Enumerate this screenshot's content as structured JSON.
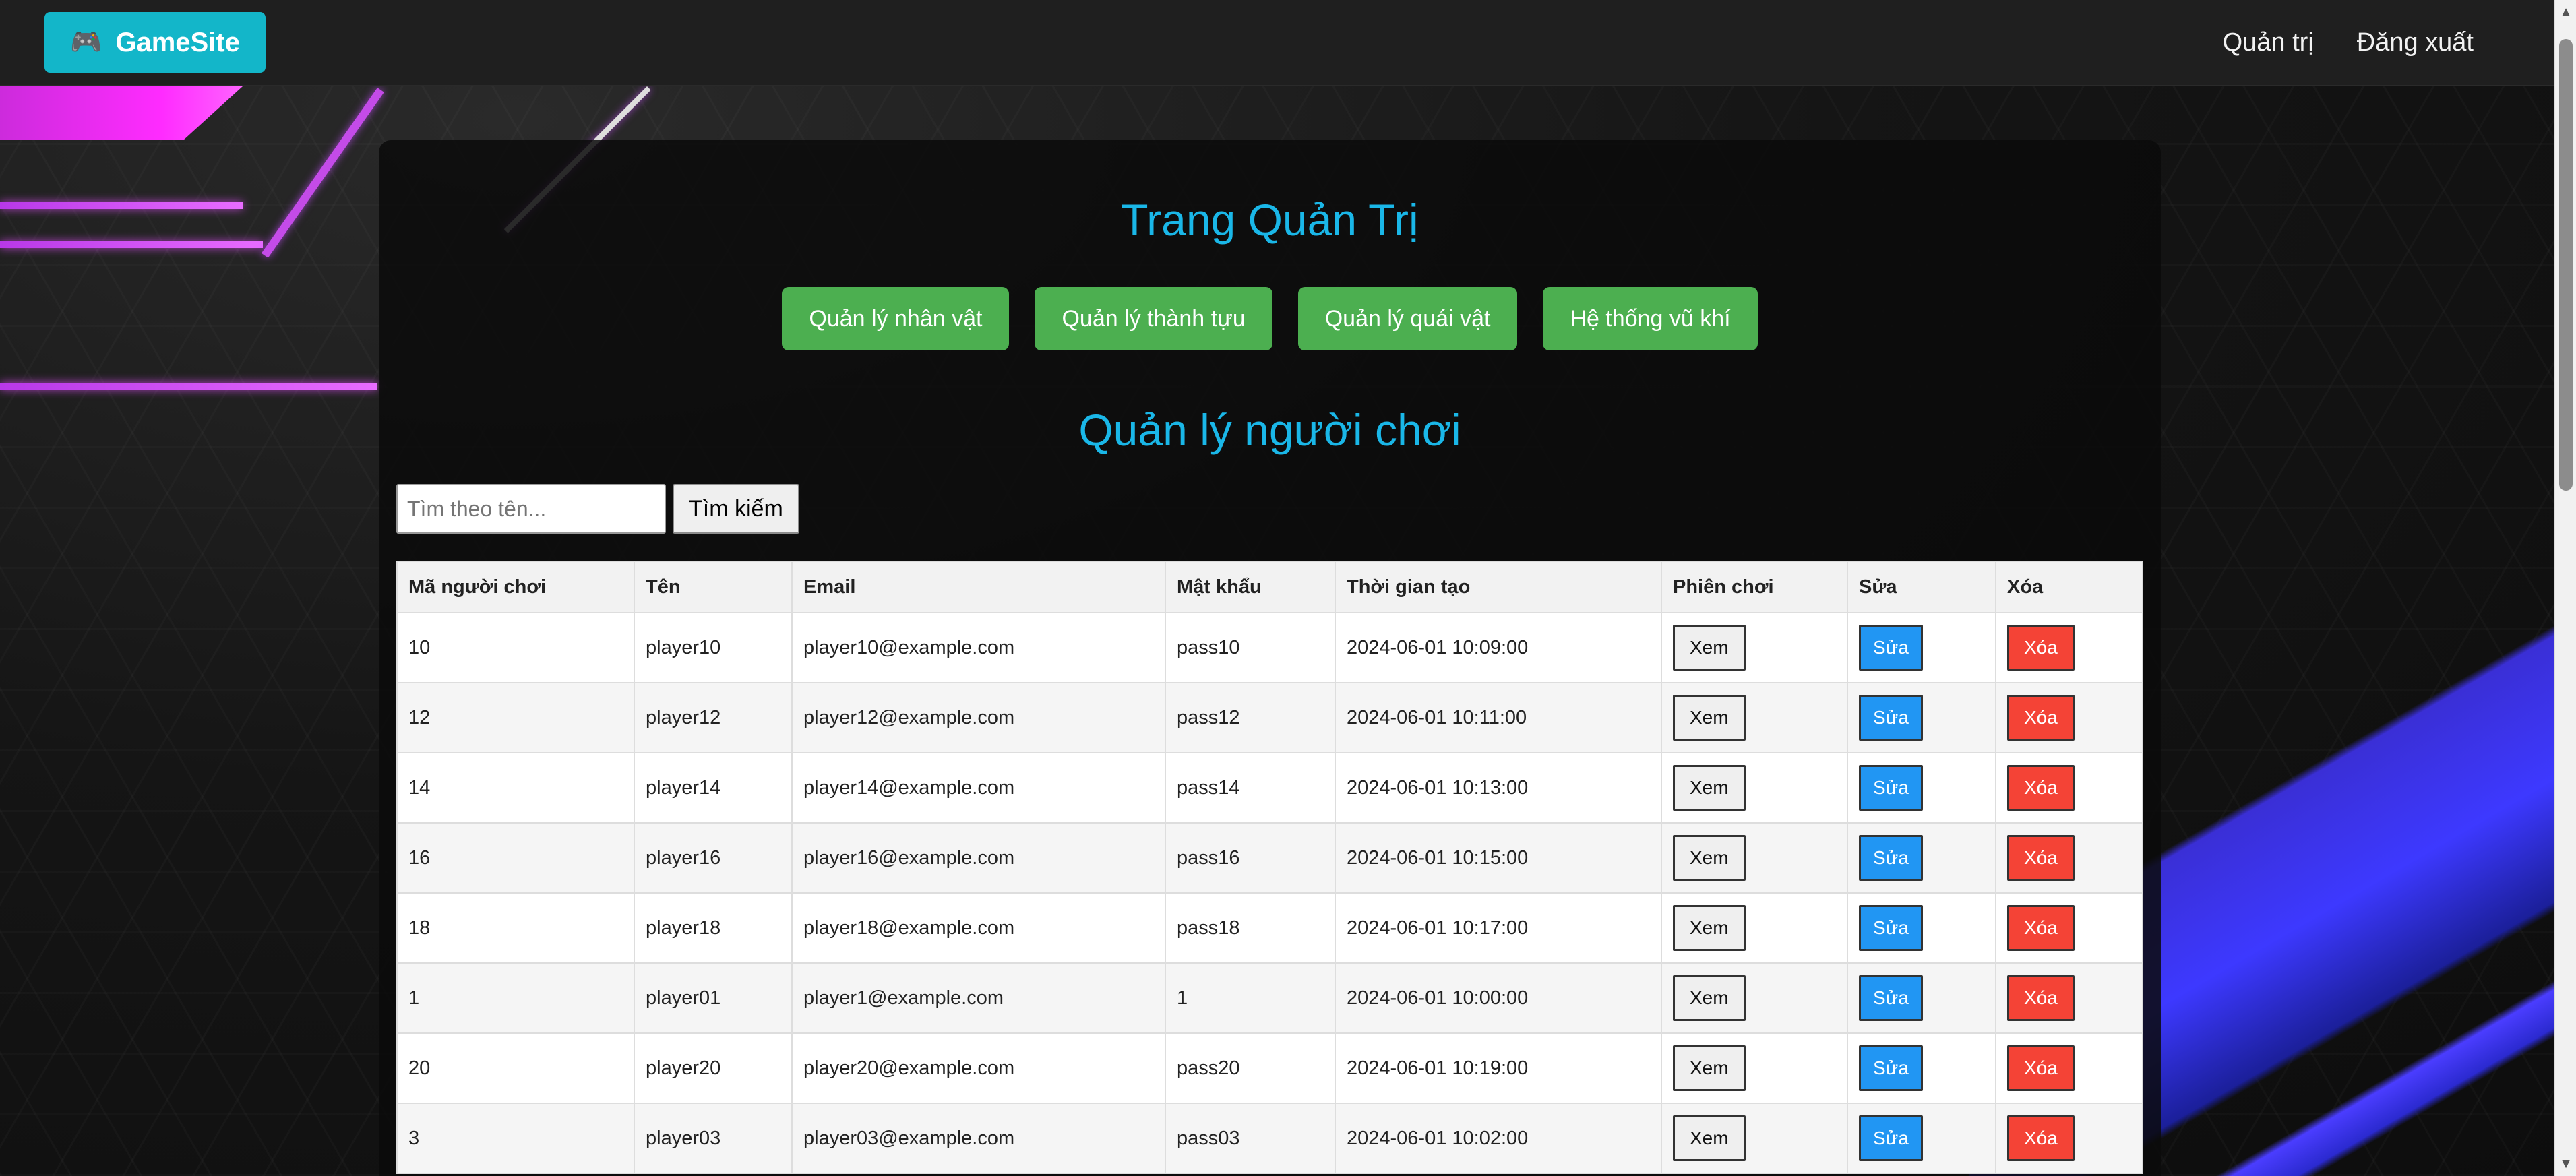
{
  "navbar": {
    "brand_icon": "🎮",
    "brand_icon_name": "gamepad-icon",
    "brand": "GameSite",
    "links": [
      "Quản trị",
      "Đăng xuất"
    ]
  },
  "admin": {
    "title": "Trang Quản Trị",
    "buttons": [
      "Quản lý nhân vật",
      "Quản lý thành tựu",
      "Quản lý quái vật",
      "Hệ thống vũ khí"
    ]
  },
  "players": {
    "title": "Quản lý người chơi",
    "search_placeholder": "Tìm theo tên...",
    "search_value": "",
    "search_button": "Tìm kiếm",
    "columns": [
      "Mã người chơi",
      "Tên",
      "Email",
      "Mật khẩu",
      "Thời gian tạo",
      "Phiên chơi",
      "Sửa",
      "Xóa"
    ],
    "view_label": "Xem",
    "edit_label": "Sửa",
    "delete_label": "Xóa",
    "rows": [
      {
        "id": "10",
        "name": "player10",
        "email": "player10@example.com",
        "password": "pass10",
        "created": "2024-06-01 10:09:00"
      },
      {
        "id": "12",
        "name": "player12",
        "email": "player12@example.com",
        "password": "pass12",
        "created": "2024-06-01 10:11:00"
      },
      {
        "id": "14",
        "name": "player14",
        "email": "player14@example.com",
        "password": "pass14",
        "created": "2024-06-01 10:13:00"
      },
      {
        "id": "16",
        "name": "player16",
        "email": "player16@example.com",
        "password": "pass16",
        "created": "2024-06-01 10:15:00"
      },
      {
        "id": "18",
        "name": "player18",
        "email": "player18@example.com",
        "password": "pass18",
        "created": "2024-06-01 10:17:00"
      },
      {
        "id": "1",
        "name": "player01",
        "email": "player1@example.com",
        "password": "1",
        "created": "2024-06-01 10:00:00"
      },
      {
        "id": "20",
        "name": "player20",
        "email": "player20@example.com",
        "password": "pass20",
        "created": "2024-06-01 10:19:00"
      },
      {
        "id": "3",
        "name": "player03",
        "email": "player03@example.com",
        "password": "pass03",
        "created": "2024-06-01 10:02:00"
      }
    ]
  },
  "colors": {
    "accent_cyan": "#13b6c9",
    "title_blue": "#1ab7e8",
    "green": "#4caf50",
    "edit_blue": "#2196f3",
    "delete_red": "#f44336"
  }
}
